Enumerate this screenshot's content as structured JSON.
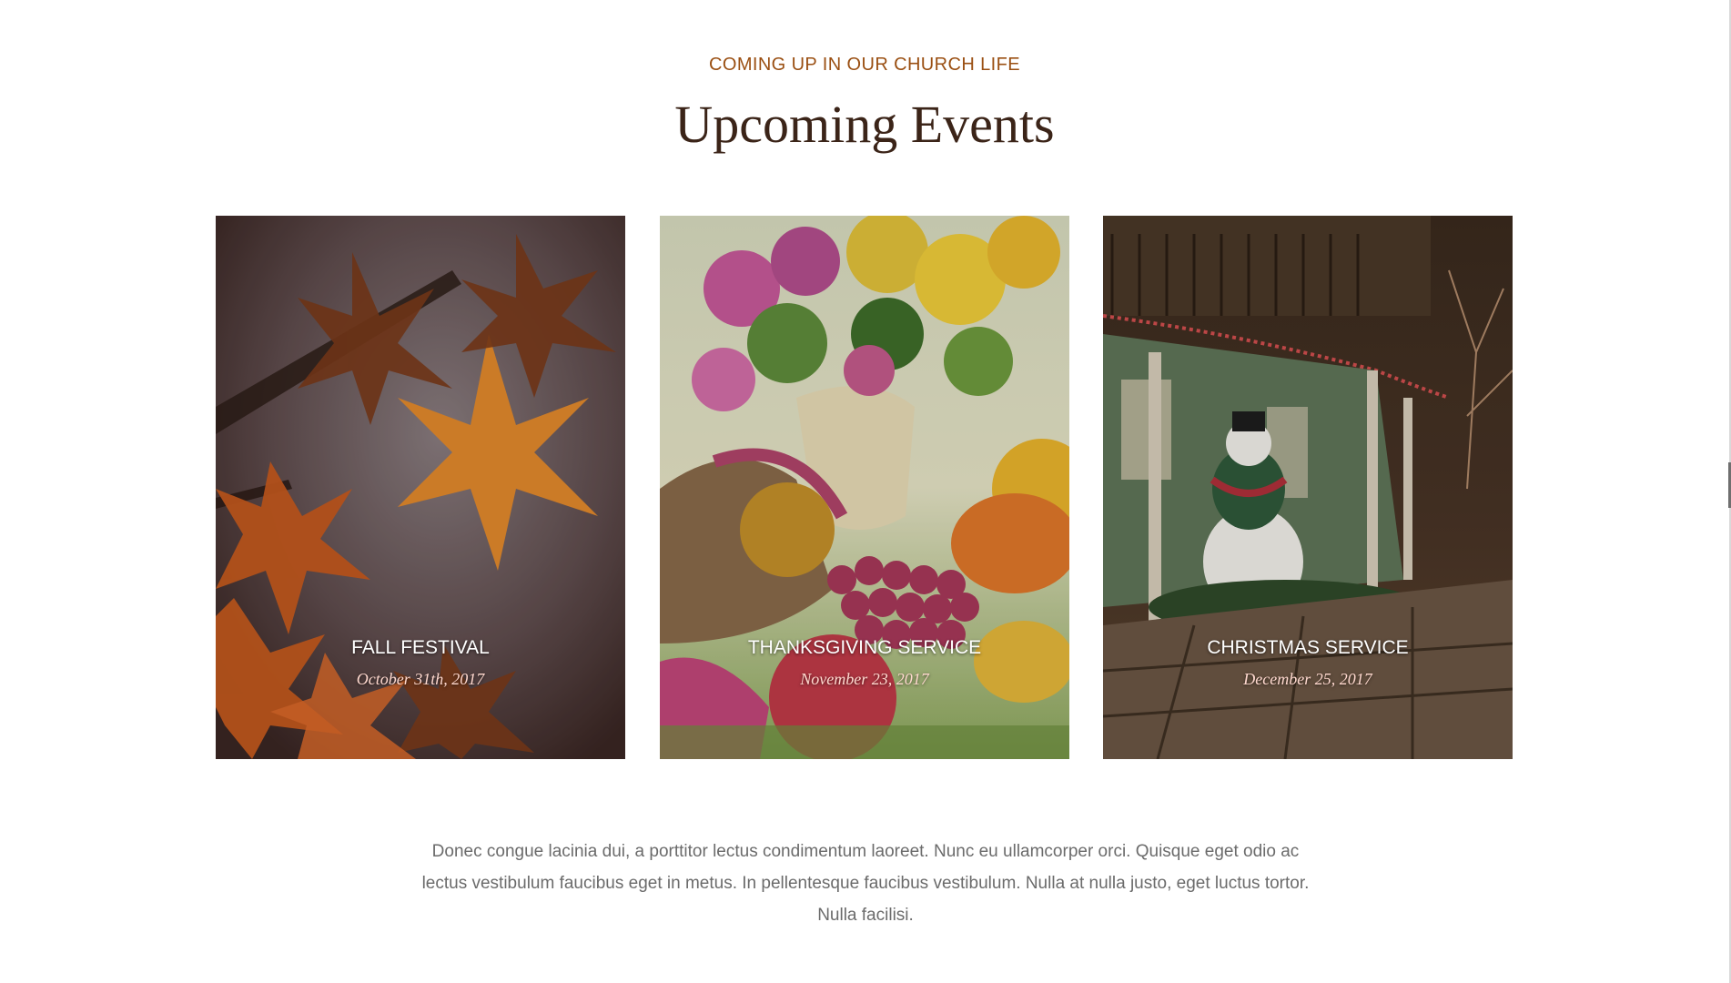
{
  "section": {
    "eyebrow": "COMING UP IN OUR CHURCH LIFE",
    "title": "Upcoming Events"
  },
  "events": [
    {
      "title": "FALL FESTIVAL",
      "date": "October 31th, 2017",
      "image": "autumn-leaves-image"
    },
    {
      "title": "THANKSGIVING SERVICE",
      "date": "November 23, 2017",
      "image": "harvest-cornucopia-image"
    },
    {
      "title": "CHRISTMAS SERVICE",
      "date": "December 25, 2017",
      "image": "snowman-porch-image"
    }
  ],
  "description": "Donec congue lacinia dui, a porttitor lectus condimentum laoreet. Nunc eu ullamcorper orci. Quisque eget odio ac lectus vestibulum faucibus eget in metus. In pellentesque faucibus vestibulum. Nulla at nulla justo, eget luctus tortor. Nulla facilisi.",
  "colors": {
    "eyebrow": "#9a4f12",
    "title": "#3b2418",
    "date": "#ffd9cf",
    "body_text": "#6b6b6b"
  }
}
